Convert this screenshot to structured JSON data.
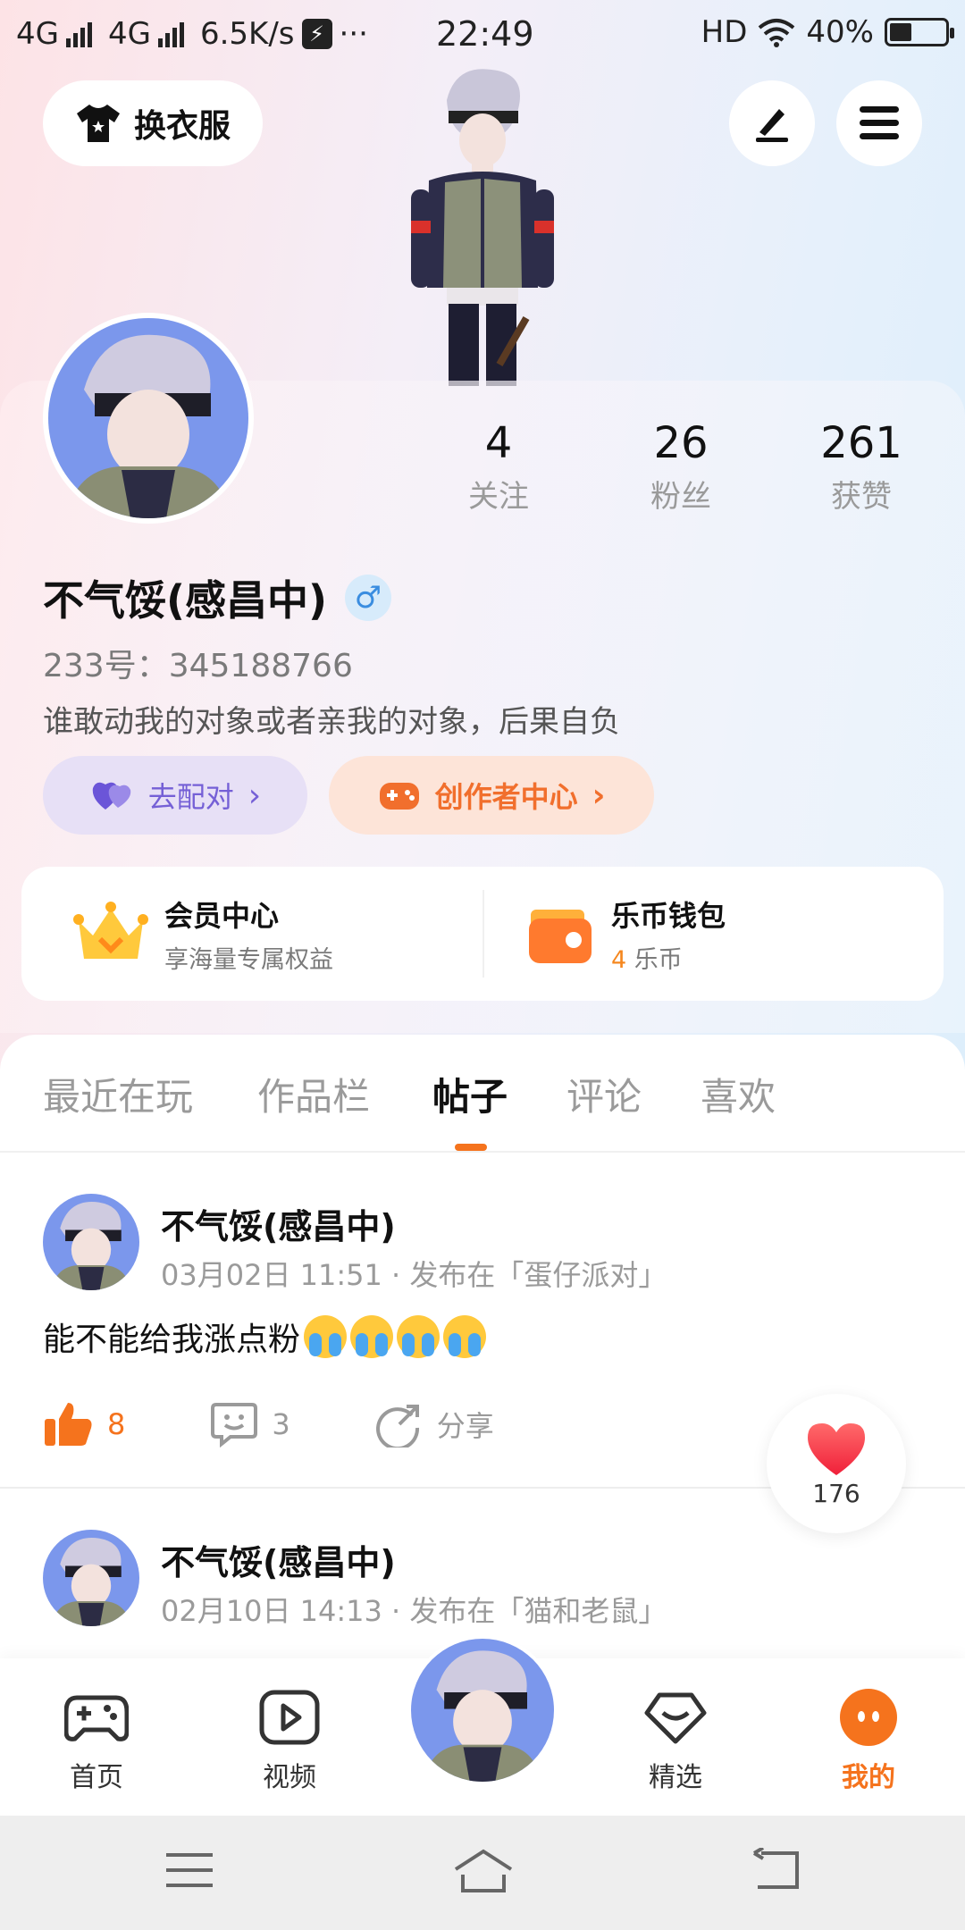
{
  "statusbar": {
    "net1": "4G",
    "net2": "4G",
    "speed": "6.5K/s",
    "dots": "···",
    "time": "22:49",
    "hd": "HD",
    "battery": "40%"
  },
  "top": {
    "outfit_label": "换衣服"
  },
  "profile": {
    "following_count": "4",
    "following_label": "关注",
    "fans_count": "26",
    "fans_label": "粉丝",
    "likes_count": "261",
    "likes_label": "获赞",
    "username": "不气馁(感昌中)",
    "gender": "♂",
    "user_id": "233号：345188766",
    "bio": "谁敢动我的对象或者亲我的对象，后果自负",
    "match_label": "去配对",
    "creator_label": "创作者中心"
  },
  "vip": {
    "member_title": "会员中心",
    "member_sub": "享海量专属权益",
    "wallet_title": "乐币钱包",
    "wallet_amount": "4",
    "wallet_unit": " 乐币"
  },
  "tabs": [
    "最近在玩",
    "作品栏",
    "帖子",
    "评论",
    "喜欢"
  ],
  "posts": [
    {
      "author": "不气馁(感昌中)",
      "meta": "03月02日 11:51 · 发布在「蛋仔派对」",
      "text": "能不能给我涨点粉",
      "likes": "8",
      "comments": "3",
      "share": "分享"
    },
    {
      "author": "不气馁(感昌中)",
      "meta": "02月10日 14:13 · 发布在「猫和老鼠」"
    }
  ],
  "float_like_count": "176",
  "bottom_nav": {
    "home": "首页",
    "video": "视频",
    "featured": "精选",
    "mine": "我的"
  },
  "colors": {
    "accent": "#f5731d",
    "match": "#7560d6",
    "gender": "#3a8de0"
  }
}
